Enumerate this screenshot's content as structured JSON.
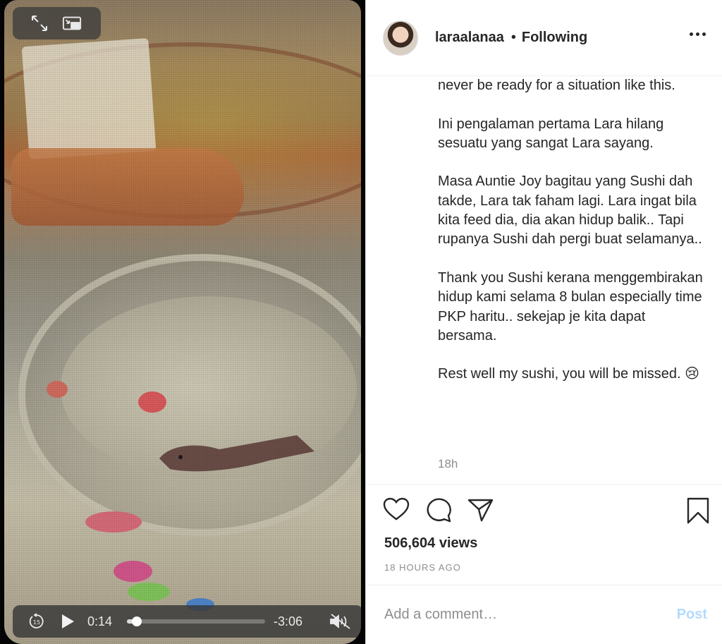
{
  "video": {
    "current_time": "0:14",
    "remaining_time": "-3:06",
    "progress": 0.07,
    "top_controls": [
      "expand-icon",
      "picture-in-picture-icon"
    ],
    "bottom_controls": [
      "skip-back-15-icon",
      "play-icon",
      "mute-icon"
    ],
    "skip_label": "15"
  },
  "post": {
    "username": "laraalanaa",
    "separator": "•",
    "follow_label": "Following",
    "caption": [
      "never be ready for a situation like this.",
      "Ini pengalaman pertama Lara hilang sesuatu yang sangat Lara sayang.",
      "Masa Auntie Joy bagitau yang Sushi dah takde, Lara tak faham lagi. Lara ingat bila kita feed dia, dia akan hidup balik.. Tapi rupanya Sushi dah pergi buat selamanya..",
      "Thank you Sushi kerana menggembirakan hidup kami selama 8 bulan especially time PKP haritu.. sekejap je kita dapat bersama.",
      "Rest well my sushi, you will be missed. 😢"
    ],
    "age": "18h",
    "views": "506,604 views",
    "date": "18 HOURS AGO"
  },
  "comment": {
    "placeholder": "Add a comment…",
    "post_label": "Post"
  },
  "colors": {
    "text": "#262626",
    "muted": "#8e8e8e",
    "post_disabled": "#b3dbff",
    "border": "#efefef"
  }
}
